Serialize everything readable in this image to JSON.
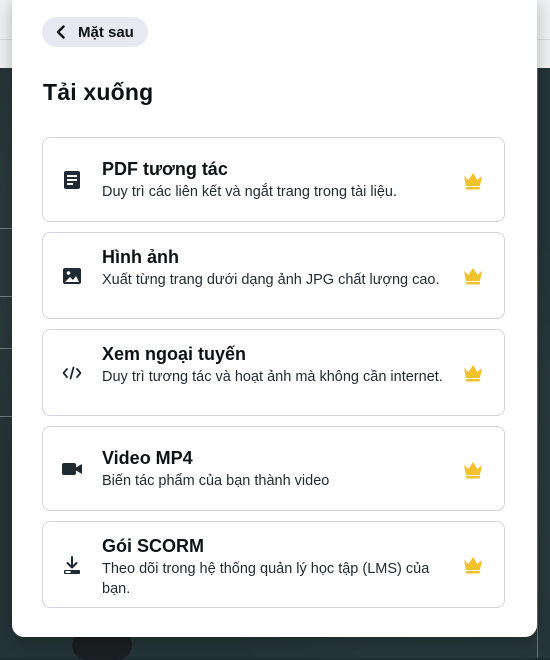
{
  "panel": {
    "back_label": "Mặt sau",
    "title": "Tải xuống"
  },
  "items": [
    {
      "label": "PDF tương tác",
      "desc": "Duy trì các liên kết và ngắt trang trong tài liệu.",
      "icon": "document-icon"
    },
    {
      "label": "Hình ảnh",
      "desc": "Xuất từng trang dưới dạng ảnh JPG chất lượng cao.",
      "icon": "image-icon"
    },
    {
      "label": "Xem ngoại tuyến",
      "desc": "Duy trì tương tác và hoạt ảnh mà không cần internet.",
      "icon": "code-icon"
    },
    {
      "label": "Video MP4",
      "desc": "Biến tác phẩm của bạn thành video",
      "icon": "video-icon"
    },
    {
      "label": "Gói SCORM",
      "desc": "Theo dõi trong hệ thống quản lý học tập (LMS) của bạn.",
      "icon": "download-icon"
    }
  ],
  "colors": {
    "crown": "#f2c12e",
    "border": "#d3d5dc",
    "back_button_bg": "#e8e8f2"
  }
}
